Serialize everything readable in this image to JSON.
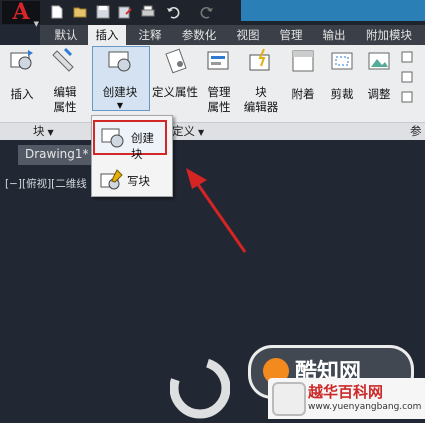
{
  "app": {
    "logo_letter": "A"
  },
  "quick_access": {
    "items": [
      "new-icon",
      "open-icon",
      "save-icon",
      "save-as-icon",
      "print-icon",
      "undo-icon",
      "redo-icon"
    ]
  },
  "ribbon_tabs": [
    "默认",
    "插入",
    "注释",
    "参数化",
    "视图",
    "管理",
    "输出",
    "附加模块"
  ],
  "active_tab": "插入",
  "ribbon": {
    "insert": {
      "line1": "插入",
      "line2": ""
    },
    "edit_attr": {
      "line1": "编辑",
      "line2": "属性"
    },
    "create_block": {
      "line1": "创建块",
      "line2": ""
    },
    "define_attr": {
      "line1": "定义属性",
      "line2": ""
    },
    "manage_attr": {
      "line1": "管理",
      "line2": "属性"
    },
    "block_editor": {
      "line1": "块",
      "line2": "编辑器"
    },
    "attach": {
      "line1": "附着",
      "line2": ""
    },
    "clip": {
      "line1": "剪裁",
      "line2": ""
    },
    "adjust": {
      "line1": "调整",
      "line2": ""
    }
  },
  "panels": {
    "block": "块",
    "block_def": "定义",
    "reference": "参"
  },
  "file_tab": {
    "name": "Drawing1*"
  },
  "viewport_label": "[−][俯视][二维线",
  "dropdown": {
    "create_block": "创建块",
    "write_block": "写块"
  },
  "watermarks": {
    "zhishi": "酷知网",
    "site_name": "越华百科网",
    "site_url": "www.yuenyangbang.com"
  },
  "colors": {
    "accent_red": "#d22828",
    "ribbon_bg": "#ecedef",
    "canvas_bg": "#222833"
  }
}
